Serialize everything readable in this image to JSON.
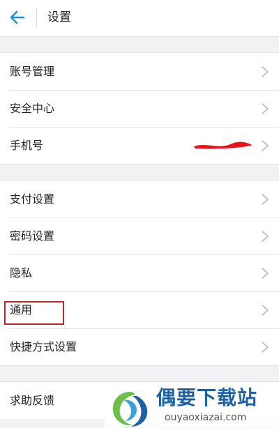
{
  "header": {
    "title": "设置",
    "back_icon": "arrow-left-icon",
    "accent_color": "#1f8fd6"
  },
  "groups": [
    {
      "items": [
        {
          "label": "账号管理"
        },
        {
          "label": "安全中心"
        },
        {
          "label": "手机号",
          "value_redacted": true
        }
      ]
    },
    {
      "items": [
        {
          "label": "支付设置"
        },
        {
          "label": "密码设置"
        },
        {
          "label": "隐私"
        },
        {
          "label": "通用",
          "highlighted": true
        },
        {
          "label": "快捷方式设置"
        }
      ]
    },
    {
      "items": [
        {
          "label": "求助反馈"
        }
      ]
    }
  ],
  "annotation": {
    "highlight_color": "#c0262e"
  },
  "watermark": {
    "title": "偶要下载站",
    "url": "ouyaoxiazai.com",
    "color": "#1d62a8"
  }
}
